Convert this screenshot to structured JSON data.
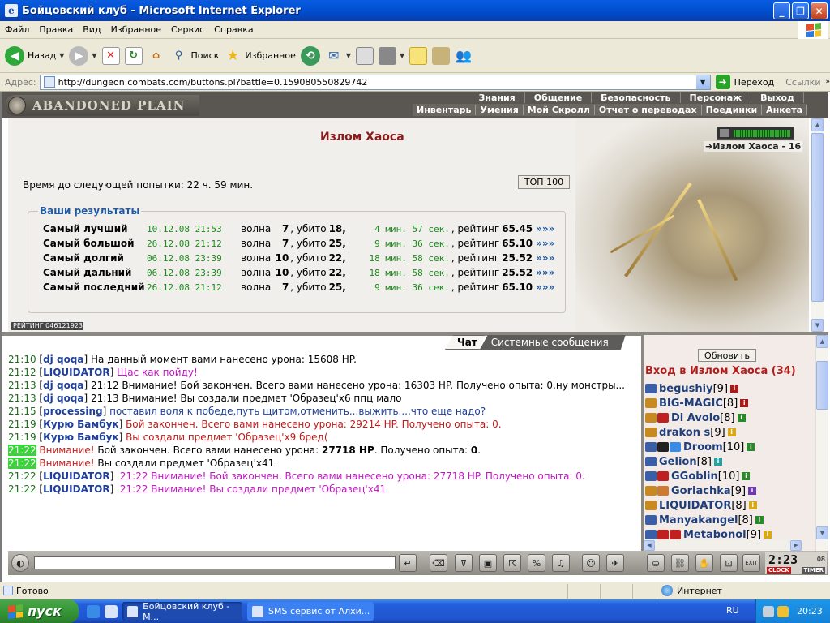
{
  "window": {
    "title": "Бойцовский клуб - Microsoft Internet Explorer"
  },
  "menu": [
    "Файл",
    "Правка",
    "Вид",
    "Избранное",
    "Сервис",
    "Справка"
  ],
  "toolbar": {
    "back": "Назад",
    "search": "Поиск",
    "favorites": "Избранное"
  },
  "address": {
    "label": "Адрес:",
    "url": "http://dungeon.combats.com/buttons.pl?battle=0.159080550829742",
    "go": "Переход",
    "links": "Ссылки"
  },
  "game": {
    "logo": "ABANDONED PLAIN",
    "nav_top": [
      "Знания",
      "Общение",
      "Безопасность",
      "Персонаж",
      "Выход"
    ],
    "nav_bottom": [
      "Инвентарь",
      "Умения",
      "Мой Скролл",
      "Отчет о переводах",
      "Поединки",
      "Анкета"
    ],
    "title": "Излом Хаоса",
    "zone_label": "Излом Хаоса - 16",
    "timer": "Время до следующей попытки: 22 ч. 59 мин.",
    "top_button": "ТОП 100",
    "rating_strip": "РЕЙТИНГ 046121923",
    "results": {
      "legend": "Ваши результаты",
      "wave_label": "волна",
      "kills_label": ", убито",
      "rating_label": ", рейтинг",
      "more": "»»»",
      "rows": [
        {
          "name": "Самый лучший",
          "date": "10.12.08 21:53",
          "wave": "7",
          "kills": "18,",
          "time": "4 мин. 57 сек.",
          "rating": "65.45"
        },
        {
          "name": "Самый большой",
          "date": "26.12.08 21:12",
          "wave": "7",
          "kills": "25,",
          "time": "9 мин. 36 сек.",
          "rating": "65.10"
        },
        {
          "name": "Самый долгий",
          "date": "06.12.08 23:39",
          "wave": "10",
          "kills": "22,",
          "time": "18 мин. 58 сек.",
          "rating": "25.52"
        },
        {
          "name": "Самый дальний",
          "date": "06.12.08 23:39",
          "wave": "10",
          "kills": "22,",
          "time": "18 мин. 58 сек.",
          "rating": "25.52"
        },
        {
          "name": "Самый последний",
          "date": "26.12.08 21:12",
          "wave": "7",
          "kills": "25,",
          "time": "9 мин. 36 сек.",
          "rating": "65.10"
        }
      ]
    }
  },
  "chat": {
    "tabs": [
      "Чат",
      "Системные сообщения"
    ],
    "messages": [
      {
        "time": "21:10",
        "nick": "dj qoqa",
        "text": " На данный момент вами нанесено урона: 15608 HP."
      },
      {
        "time": "21:12",
        "nick": "LIQUIDATOR",
        "text": " Щас как пойду!"
      },
      {
        "time": "21:13",
        "nick": "dj qoqa",
        "text": " 21:12 Внимание! Бой закончен. Всего вами нанесено урона: 16303 HP. Получено опыта: 0.ну монстры..."
      },
      {
        "time": "21:13",
        "nick": "dj qoqa",
        "text": " 21:13 Внимание! Вы создали предмет 'Образец'x6 ппц мало"
      },
      {
        "time": "21:15",
        "nick": "processing",
        "text": " поставил воля к победе,путь щитом,отменить...выжить....что еще надо?"
      },
      {
        "time": "21:19",
        "nick": "Курю Бамбук",
        "text": " Бой закончен. Всего вами нанесено урона: 29214 HP. Получено опыта: 0."
      },
      {
        "time": "21:19",
        "nick": "Курю Бамбук",
        "text": " Вы создали предмет 'Образец'x9 бред("
      },
      {
        "time": "21:22",
        "alert": "Внимание!",
        "text_a": " Бой закончен. Всего вами нанесено урона: ",
        "bold1": "27718 HP",
        "text_b": ". Получено опыта: ",
        "bold2": "0",
        "text_c": "."
      },
      {
        "time": "21:22",
        "alert": "Внимание!",
        "text": " Вы создали предмет 'Образец'x41"
      },
      {
        "time": "21:22",
        "nick": "LIQUIDATOR",
        "text": " 21:22 Внимание! Бой закончен. Всего вами нанесено урона: 27718 HP. Получено опыта: 0."
      },
      {
        "time": "21:22",
        "nick": "LIQUIDATOR",
        "text": " 21:22 Внимание! Вы создали предмет 'Образец'x41"
      }
    ]
  },
  "room": {
    "refresh": "Обновить",
    "title": "Вход в Излом Хаоса (34)",
    "players": [
      {
        "name": "begushiy",
        "level": "[9]"
      },
      {
        "name": "BIG-MAGIC",
        "level": "[8]"
      },
      {
        "name": "Di Avolo",
        "level": "[8]"
      },
      {
        "name": "drakon s",
        "level": "[9]"
      },
      {
        "name": "Droom",
        "level": "[10]"
      },
      {
        "name": "Gelion",
        "level": "[8]"
      },
      {
        "name": "GGoblin",
        "level": "[10]"
      },
      {
        "name": "Goriachka",
        "level": "[9]"
      },
      {
        "name": "LIQUIDATOR",
        "level": "[8]"
      },
      {
        "name": "Manyakangel",
        "level": "[8]"
      },
      {
        "name": "Metabonol",
        "level": "[9]"
      }
    ]
  },
  "clock": {
    "time": "2:23",
    "seconds": "08",
    "clock_label": "CLOCK",
    "timer_label": "TIMER"
  },
  "status": {
    "done": "Готово",
    "zone": "Интернет"
  },
  "taskbar": {
    "start": "пуск",
    "tasks": [
      "Бойцовский клуб - М...",
      "SMS сервис от Алхи..."
    ],
    "lang": "RU",
    "time": "20:23"
  }
}
